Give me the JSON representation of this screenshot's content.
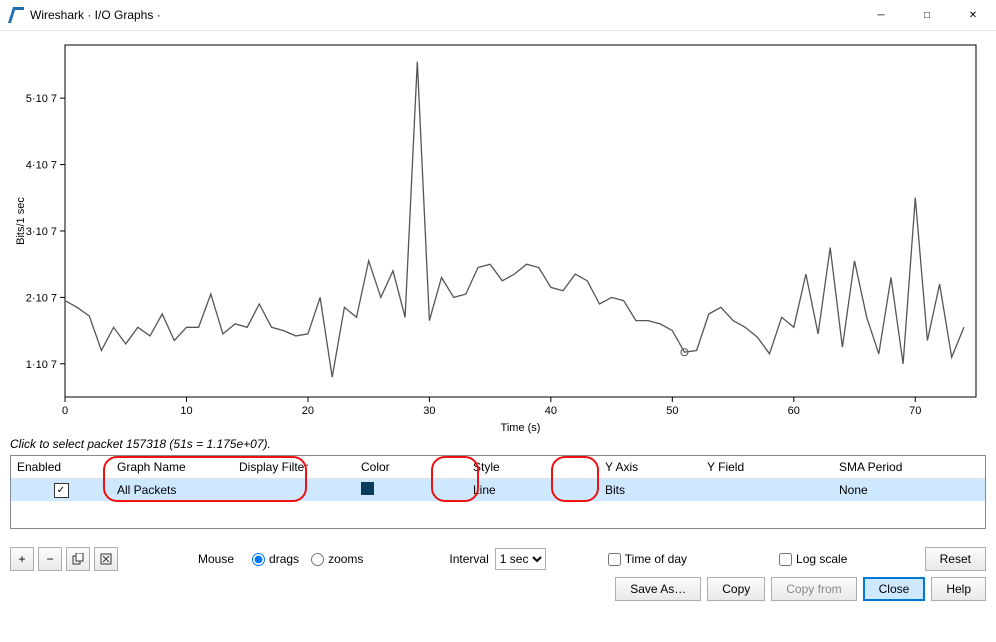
{
  "window": {
    "title": "Wireshark · I/O Graphs ·"
  },
  "chart_data": {
    "type": "line",
    "xlabel": "Time (s)",
    "ylabel": "Bits/1 sec",
    "xlim": [
      0,
      75
    ],
    "ylim": [
      5000000.0,
      58000000.0
    ],
    "x_ticks": [
      0,
      10,
      20,
      30,
      40,
      50,
      60,
      70
    ],
    "y_ticks": [
      10000000.0,
      20000000.0,
      30000000.0,
      40000000.0,
      50000000.0
    ],
    "y_tick_labels": [
      "1·10 7",
      "2·10 7",
      "3·10 7",
      "4·10 7",
      "5·10 7"
    ],
    "hover_point": {
      "x": 51,
      "y": 11750000.0
    },
    "series": [
      {
        "name": "All Packets",
        "color": "#555",
        "x": [
          0,
          1,
          2,
          3,
          4,
          5,
          6,
          7,
          8,
          9,
          10,
          11,
          12,
          13,
          14,
          15,
          16,
          17,
          18,
          19,
          20,
          21,
          22,
          23,
          24,
          25,
          26,
          27,
          28,
          29,
          30,
          31,
          32,
          33,
          34,
          35,
          36,
          37,
          38,
          39,
          40,
          41,
          42,
          43,
          44,
          45,
          46,
          47,
          48,
          49,
          50,
          51,
          52,
          53,
          54,
          55,
          56,
          57,
          58,
          59,
          60,
          61,
          62,
          63,
          64,
          65,
          66,
          67,
          68,
          69,
          70,
          71,
          72,
          73,
          74
        ],
        "y": [
          19500000.0,
          18500000.0,
          17200000.0,
          12000000.0,
          15500000.0,
          13000000.0,
          15500000.0,
          14200000.0,
          17500000.0,
          13500000.0,
          15500000.0,
          15500000.0,
          20500000.0,
          14500000.0,
          16000000.0,
          15500000.0,
          19000000.0,
          15500000.0,
          15000000.0,
          14200000.0,
          14500000.0,
          20000000.0,
          8000000.0,
          18500000.0,
          17000000.0,
          25500000.0,
          20000000.0,
          24000000.0,
          17000000.0,
          55500000.0,
          16500000.0,
          23000000.0,
          20000000.0,
          20500000.0,
          24500000.0,
          25000000.0,
          22500000.0,
          23500000.0,
          25000000.0,
          24500000.0,
          21500000.0,
          21000000.0,
          23500000.0,
          22500000.0,
          19000000.0,
          20000000.0,
          19500000.0,
          16500000.0,
          16500000.0,
          16000000.0,
          15000000.0,
          11750000.0,
          12000000.0,
          17500000.0,
          18500000.0,
          16500000.0,
          15500000.0,
          14000000.0,
          11500000.0,
          17000000.0,
          15500000.0,
          23500000.0,
          14500000.0,
          27500000.0,
          12500000.0,
          25500000.0,
          17000000.0,
          11500000.0,
          23000000.0,
          10000000.0,
          35000000.0,
          13500000.0,
          22000000.0,
          11000000.0,
          15500000.0
        ]
      }
    ]
  },
  "hint": "Click to select packet 157318 (51s = 1.175e+07).",
  "table": {
    "headers": {
      "enabled": "Enabled",
      "graph_name": "Graph Name",
      "display_filter": "Display Filter",
      "color": "Color",
      "style": "Style",
      "y_axis": "Y Axis",
      "y_field": "Y Field",
      "sma_period": "SMA Period"
    },
    "rows": [
      {
        "enabled": true,
        "graph_name": "All Packets",
        "display_filter": "",
        "color": "#0b3c5d",
        "style": "Line",
        "y_axis": "Bits",
        "y_field": "",
        "sma_period": "None"
      }
    ]
  },
  "controls": {
    "mouse_label": "Mouse",
    "drags": "drags",
    "zooms": "zooms",
    "mouse_mode": "drags",
    "interval_label": "Interval",
    "interval_value": "1 sec",
    "time_of_day_label": "Time of day",
    "time_of_day": false,
    "log_scale_label": "Log scale",
    "log_scale": false,
    "reset": "Reset"
  },
  "footer": {
    "save_as": "Save As…",
    "copy": "Copy",
    "copy_from": "Copy from",
    "close": "Close",
    "help": "Help"
  }
}
